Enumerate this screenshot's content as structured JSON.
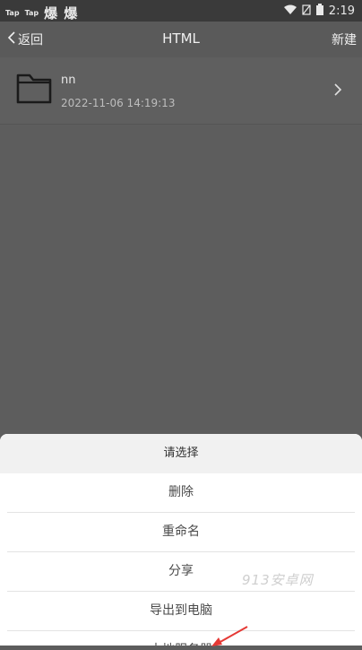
{
  "statusbar": {
    "app1": "Tap",
    "app2": "Tap",
    "notif_chars": "爆 爆",
    "time": "2:19"
  },
  "appbar": {
    "back_label": "返回",
    "title": "HTML",
    "new_label": "新建"
  },
  "files": [
    {
      "name": "nn",
      "date": "2022-11-06 14:19:13"
    }
  ],
  "sheet": {
    "header": "请选择",
    "options": [
      "删除",
      "重命名",
      "分享",
      "导出到电脑",
      "本地服务器"
    ]
  },
  "watermark": "913安卓网",
  "colors": {
    "overlay": "#5d5d5d",
    "sheet_bg": "#ffffff",
    "arrow": "#e53935"
  }
}
